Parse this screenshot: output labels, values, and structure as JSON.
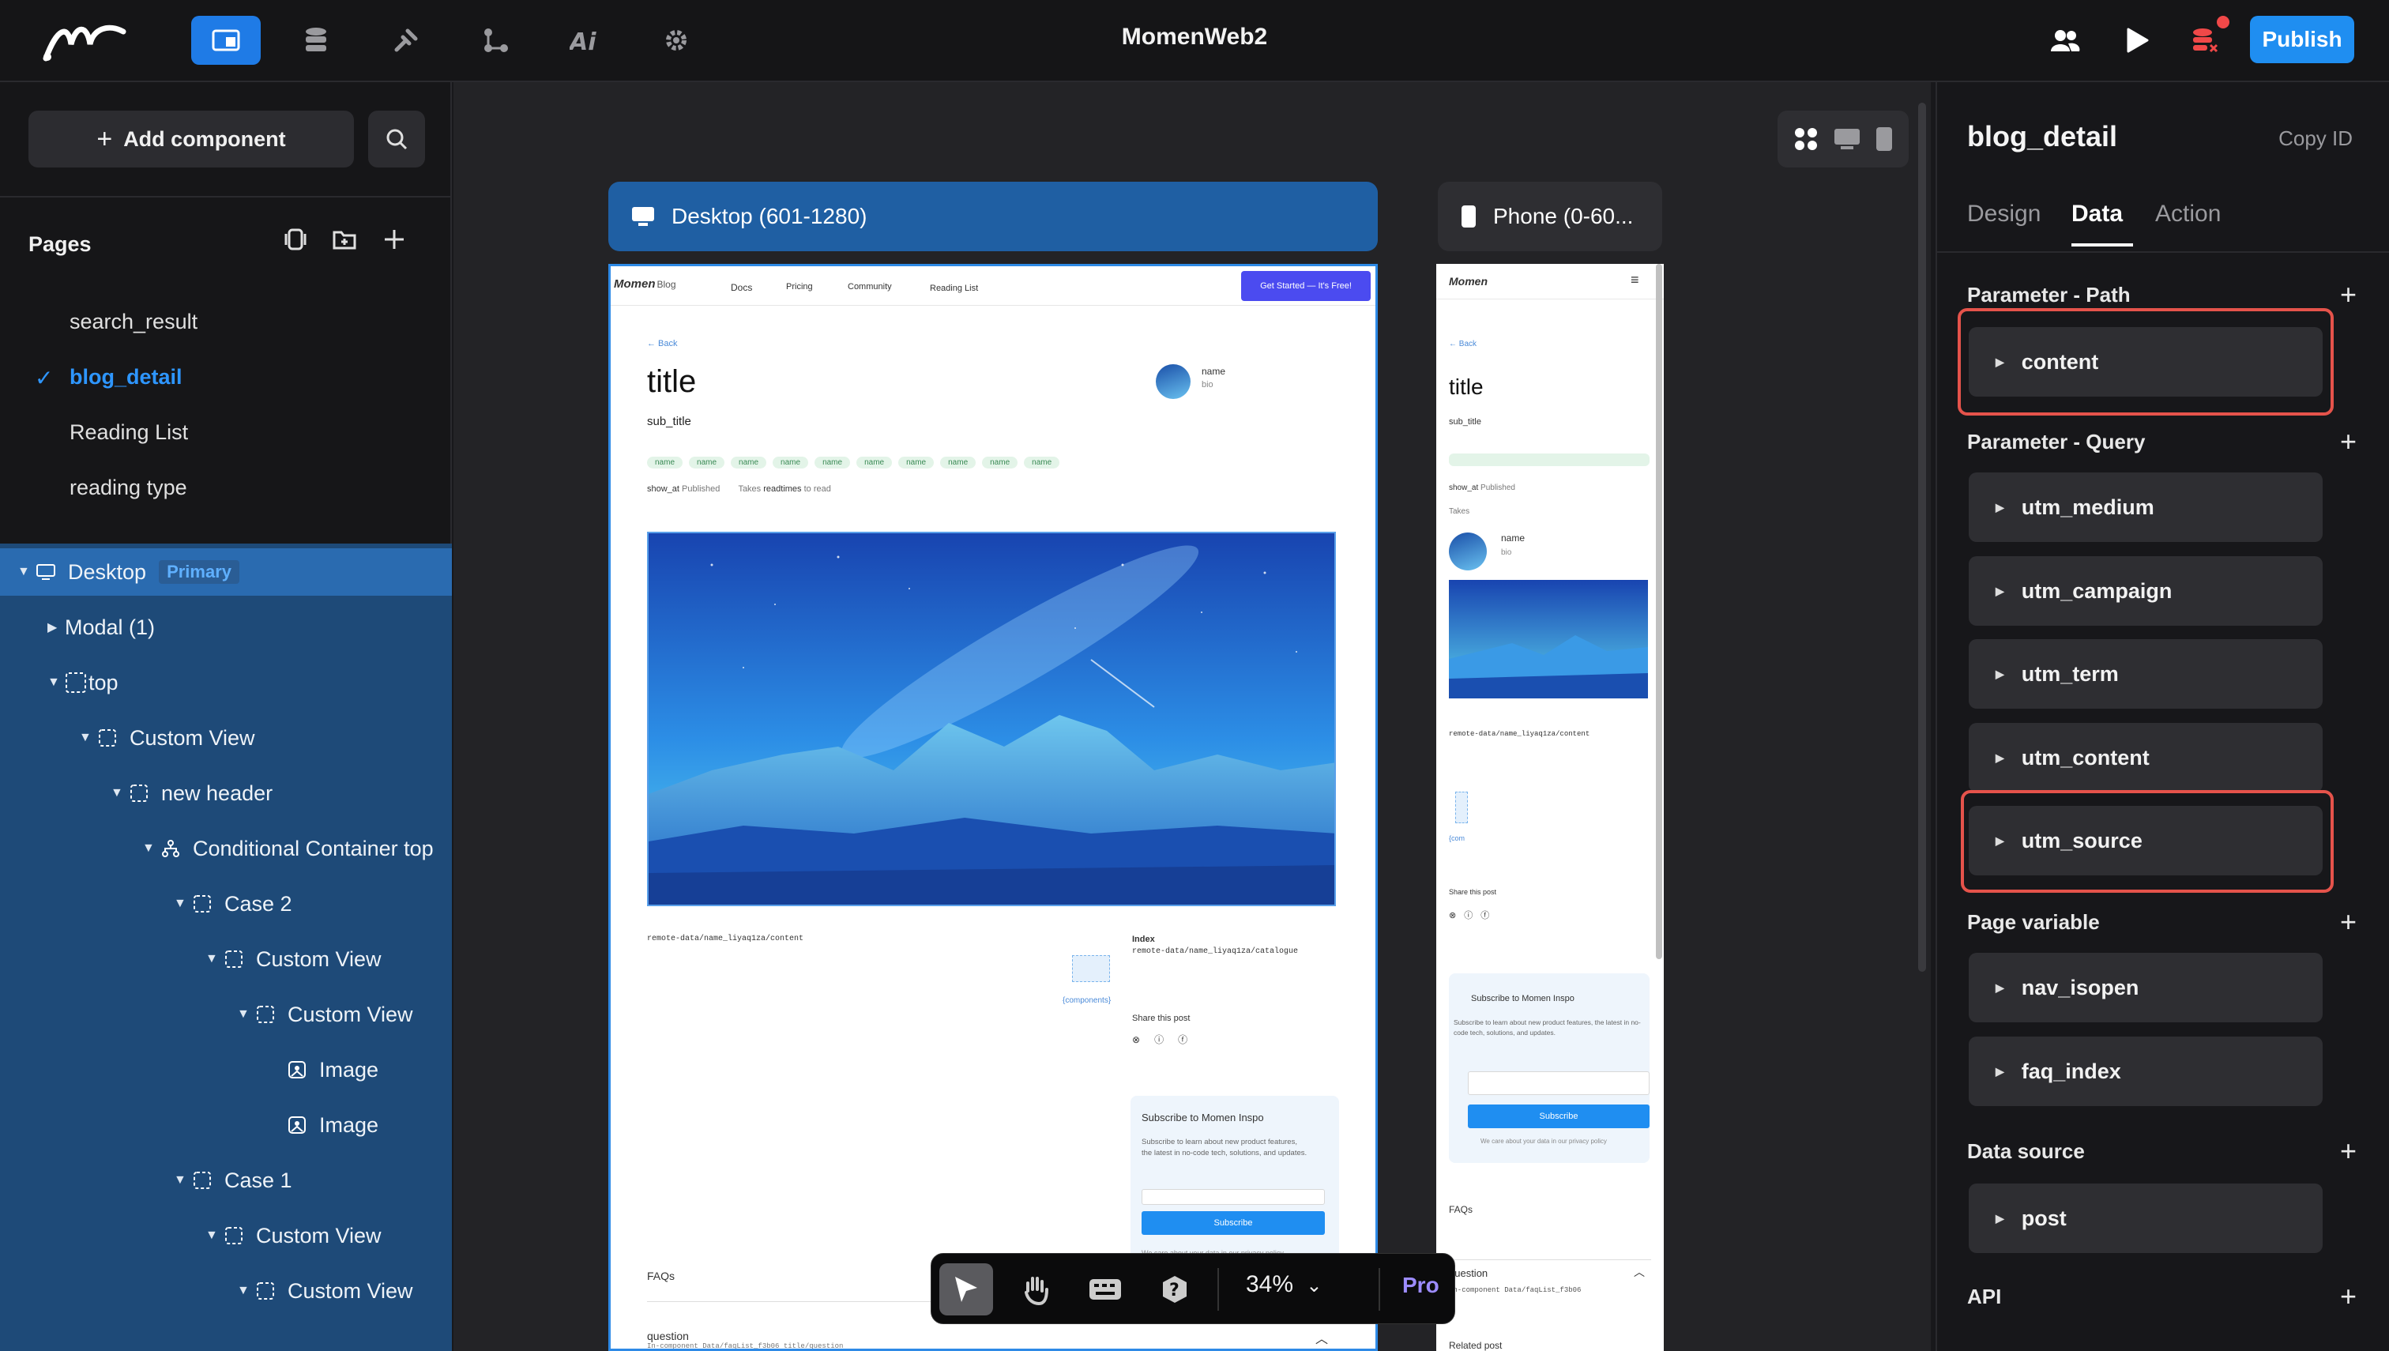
{
  "app": {
    "title": "MomenWeb2",
    "publish_label": "Publish"
  },
  "left": {
    "add_component": "Add component",
    "pages_heading": "Pages",
    "pages": [
      "search_result",
      "blog_detail",
      "Reading List",
      "reading type"
    ],
    "tree": [
      {
        "label": "Desktop",
        "badge": "Primary"
      },
      {
        "label": "Modal (1)"
      },
      {
        "label": "top"
      },
      {
        "label": "Custom View"
      },
      {
        "label": "new header"
      },
      {
        "label": "Conditional Container top"
      },
      {
        "label": "Case 2"
      },
      {
        "label": "Custom View"
      },
      {
        "label": "Custom View"
      },
      {
        "label": "Image"
      },
      {
        "label": "Image"
      },
      {
        "label": "Case 1"
      },
      {
        "label": "Custom View"
      },
      {
        "label": "Custom View"
      }
    ]
  },
  "canvas": {
    "desktop_tab": "Desktop (601-1280)",
    "phone_tab": "Phone (0-60...",
    "zoom": "34%",
    "pro": "Pro",
    "desktop": {
      "brand": "Momen",
      "brand_suffix": "Blog",
      "nav": [
        "Docs",
        "Pricing",
        "Community",
        "Reading List"
      ],
      "cta": "Get Started — It's Free!",
      "back": "← Back",
      "title": "title",
      "sub_title": "sub_title",
      "author": "name",
      "bio": "bio",
      "tags": [
        "name",
        "name",
        "name",
        "name",
        "name",
        "name",
        "name",
        "name",
        "name",
        "name"
      ],
      "show_at": "show_at",
      "published": "Published",
      "takes": "Takes",
      "readtimes": "readtimes",
      "to_read": "to read",
      "content_path": "remote-data/name_liyaq1za/content",
      "index_label": "Index",
      "catalogue_path": "remote-data/name_liyaq1za/catalogue",
      "components": "{components}",
      "share": "Share this post",
      "subscribe_title": "Subscribe to Momen Inspo",
      "subscribe_text": "Subscribe to learn about new product features, the latest in no-code tech, solutions, and updates.",
      "subscribe_btn": "Subscribe",
      "care_text": "We care about your data in our privacy policy",
      "faqs": "FAQs",
      "question": "question",
      "faq_path": "In-component Data/faqList_f3b06 title/question"
    },
    "phone": {
      "brand": "Momen",
      "back": "← Back",
      "title": "title",
      "sub_title": "sub_title",
      "show_at": "show_at",
      "published": "Published",
      "takes": "Takes",
      "author": "name",
      "bio": "bio",
      "content_path": "remote-data/name_liyaq1za/content",
      "components": "{com",
      "share": "Share this post",
      "subscribe_title": "Subscribe to Momen Inspo",
      "subscribe_text": "Subscribe to learn about new product features, the latest in no-code tech, solutions, and updates.",
      "subscribe_btn": "Subscribe",
      "care_text": "We care about your data in our privacy policy",
      "faqs": "FAQs",
      "question": "question",
      "faq_path": "In-component Data/faqList_f3b06",
      "related": "Related post"
    }
  },
  "right": {
    "title": "blog_detail",
    "copy_id": "Copy ID",
    "tabs": [
      "Design",
      "Data",
      "Action"
    ],
    "sections": {
      "path": "Parameter - Path",
      "query": "Parameter - Query",
      "page_var": "Page variable",
      "data_source": "Data source",
      "api": "API"
    },
    "path_params": [
      "content"
    ],
    "query_params": [
      "utm_medium",
      "utm_campaign",
      "utm_term",
      "utm_content",
      "utm_source"
    ],
    "page_vars": [
      "nav_isopen",
      "faq_index"
    ],
    "data_sources": [
      "post"
    ]
  },
  "colors": {
    "accent": "#1f8ef1",
    "highlight": "#e5534b",
    "tree_bg": "#1e4a78"
  }
}
